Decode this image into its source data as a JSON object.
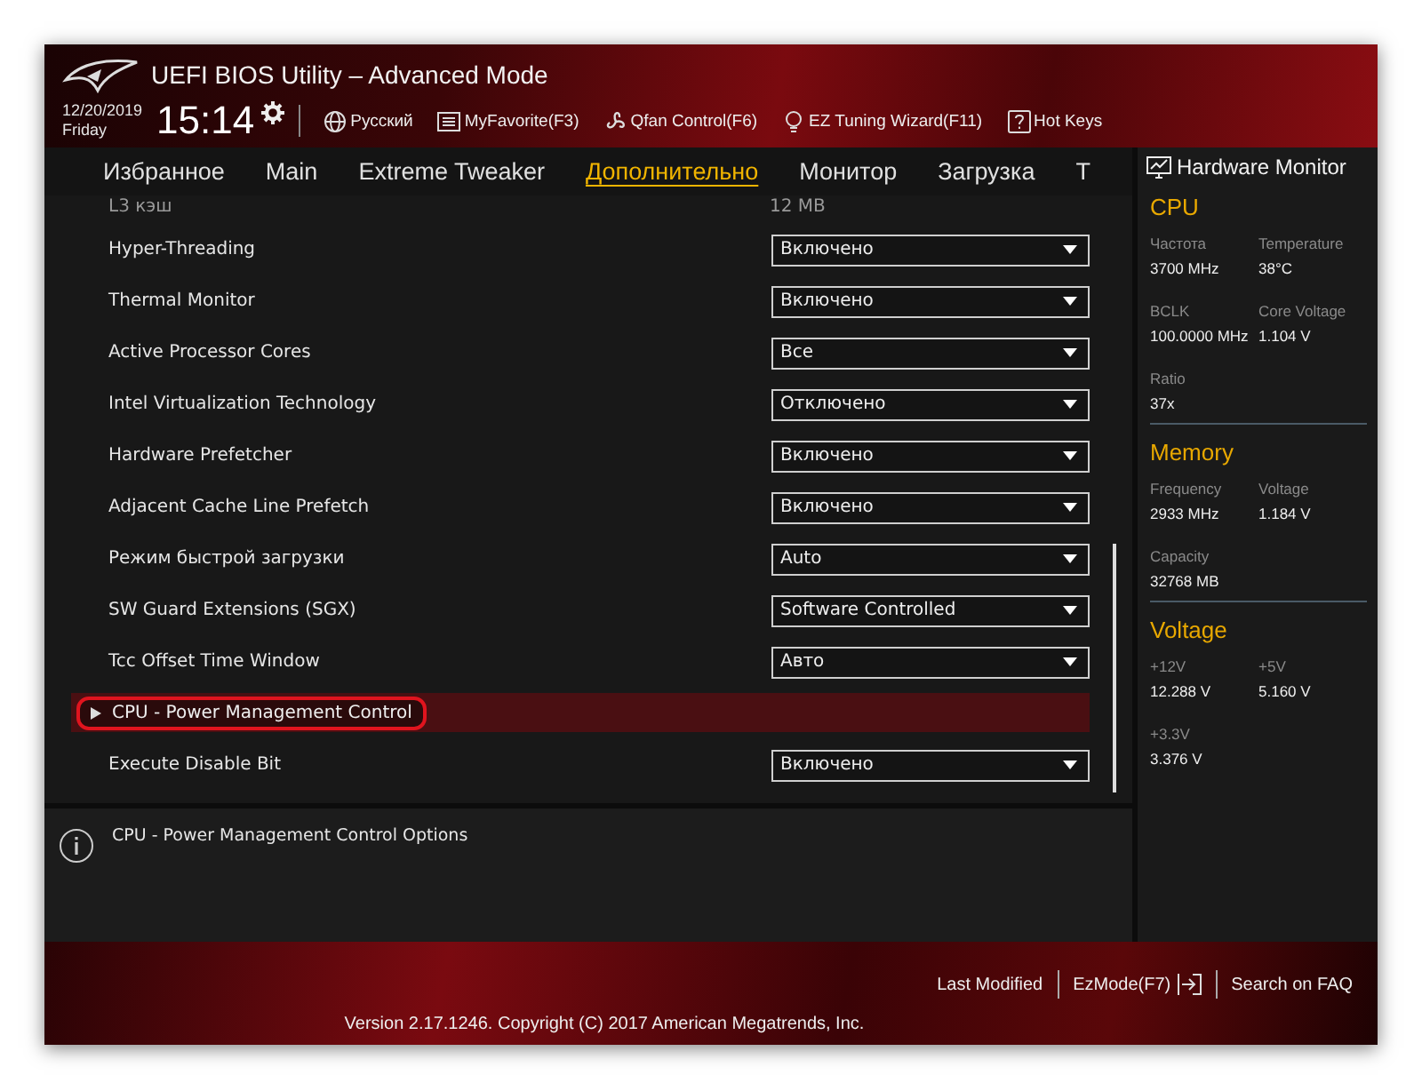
{
  "window": {
    "title": "UEFI BIOS Utility – Advanced Mode"
  },
  "clock": {
    "date": "12/20/2019",
    "day": "Friday",
    "time": "15:14"
  },
  "toolbar": [
    {
      "kind": "globe",
      "label": "Русский"
    },
    {
      "kind": "favorite",
      "label": "MyFavorite(F3)"
    },
    {
      "kind": "fan",
      "label": "Qfan Control(F6)"
    },
    {
      "kind": "bulb",
      "label": "EZ Tuning Wizard(F11)"
    },
    {
      "kind": "help",
      "label": "Hot Keys"
    }
  ],
  "tabs": [
    {
      "label": "Избранное",
      "selected": false
    },
    {
      "label": "Main",
      "selected": false
    },
    {
      "label": "Extreme Tweaker",
      "selected": false
    },
    {
      "label": "Дополнительно",
      "selected": true
    },
    {
      "label": "Монитор",
      "selected": false
    },
    {
      "label": "Загрузка",
      "selected": false
    },
    {
      "label": "T",
      "selected": false
    }
  ],
  "settings": [
    {
      "kind": "info",
      "label": "L3 кэш",
      "value": "12 MB"
    },
    {
      "kind": "select",
      "label": "Hyper-Threading",
      "value": "Включено"
    },
    {
      "kind": "select",
      "label": "Thermal Monitor",
      "value": "Включено"
    },
    {
      "kind": "select",
      "label": "Active Processor Cores",
      "value": "Все"
    },
    {
      "kind": "select",
      "label": "Intel Virtualization Technology",
      "value": "Отключено"
    },
    {
      "kind": "select",
      "label": "Hardware Prefetcher",
      "value": "Включено"
    },
    {
      "kind": "select",
      "label": "Adjacent Cache Line Prefetch",
      "value": "Включено"
    },
    {
      "kind": "select",
      "label": "Режим быстрой загрузки",
      "value": "Auto"
    },
    {
      "kind": "select",
      "label": "SW Guard Extensions (SGX)",
      "value": "Software Controlled"
    },
    {
      "kind": "select",
      "label": "Tcc Offset Time Window",
      "value": "Авто"
    },
    {
      "kind": "submenu",
      "label": "CPU - Power Management Control",
      "selected": true
    },
    {
      "kind": "select",
      "label": "Execute Disable Bit",
      "value": "Включено"
    }
  ],
  "help_text": "CPU - Power Management Control Options",
  "hardware_monitor": {
    "title": "Hardware Monitor",
    "sections": [
      {
        "title": "CPU",
        "items": [
          {
            "label": "Частота",
            "value": "3700 MHz"
          },
          {
            "label": "Temperature",
            "value": "38°C"
          },
          {
            "label": "BCLK",
            "value": "100.0000 MHz"
          },
          {
            "label": "Core Voltage",
            "value": "1.104 V"
          },
          {
            "label": "Ratio",
            "value": "37x"
          }
        ]
      },
      {
        "title": "Memory",
        "items": [
          {
            "label": "Frequency",
            "value": "2933 MHz"
          },
          {
            "label": "Voltage",
            "value": "1.184 V"
          },
          {
            "label": "Capacity",
            "value": "32768 MB"
          }
        ]
      },
      {
        "title": "Voltage",
        "items": [
          {
            "label": "+12V",
            "value": "12.288 V"
          },
          {
            "label": "+5V",
            "value": "5.160 V"
          },
          {
            "label": "+3.3V",
            "value": "3.376 V"
          }
        ]
      }
    ]
  },
  "footer": {
    "links": [
      {
        "kind": "plain",
        "label": "Last Modified"
      },
      {
        "kind": "exit",
        "label": "EzMode(F7)"
      },
      {
        "kind": "plain",
        "label": "Search on FAQ"
      }
    ],
    "version": "Version 2.17.1246. Copyright (C) 2017 American Megatrends, Inc."
  }
}
